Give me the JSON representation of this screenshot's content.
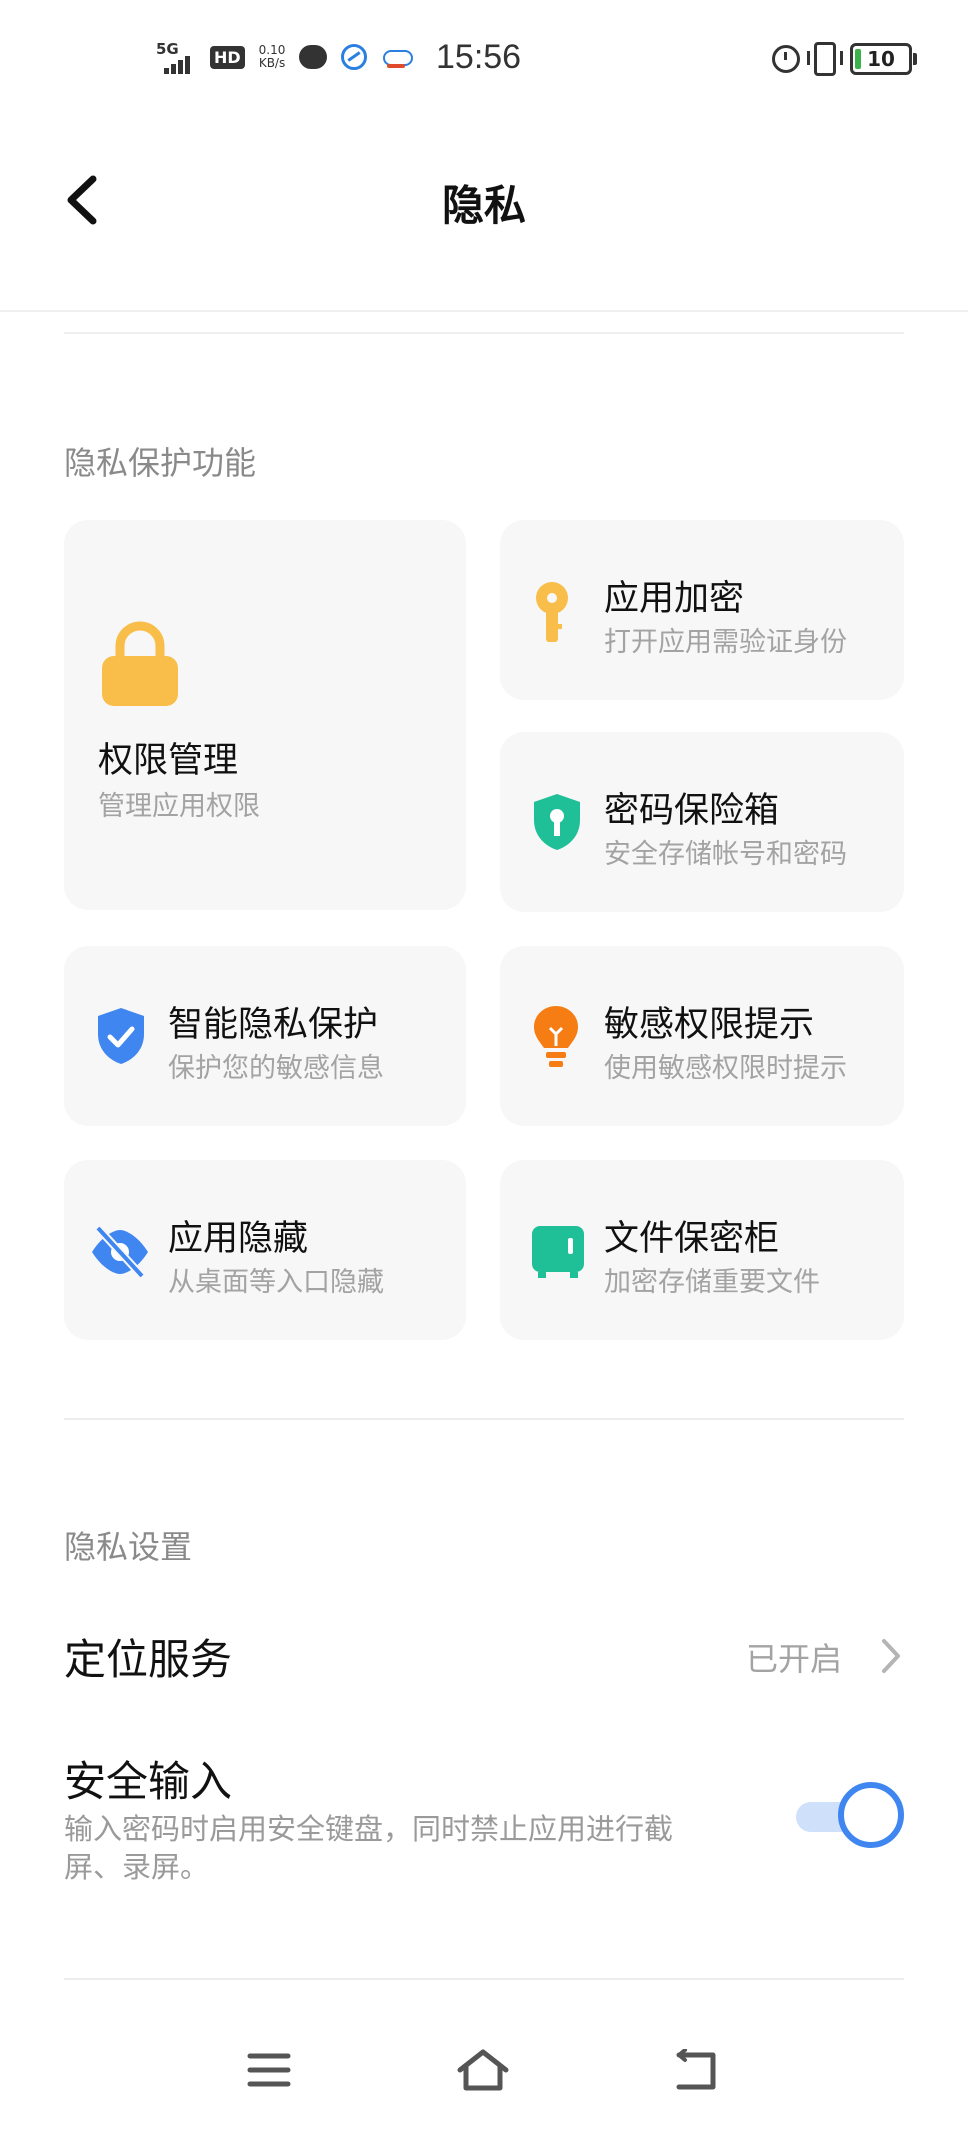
{
  "status_bar": {
    "network": "5G",
    "hd": "HD",
    "net_speed": "0.10",
    "net_unit": "KB/s",
    "time": "15:56",
    "battery": "10"
  },
  "header": {
    "title": "隐私"
  },
  "privacy_features": {
    "section_label": "隐私保护功能",
    "cards": [
      {
        "title": "权限管理",
        "subtitle": "管理应用权限",
        "icon": "lock-icon",
        "color": "#f9bd49"
      },
      {
        "title": "应用加密",
        "subtitle": "打开应用需验证身份",
        "icon": "key-icon",
        "color": "#f9bd49"
      },
      {
        "title": "密码保险箱",
        "subtitle": "安全存储帐号和密码",
        "icon": "shield-key-icon",
        "color": "#1fbf98"
      },
      {
        "title": "智能隐私保护",
        "subtitle": "保护您的敏感信息",
        "icon": "shield-check-icon",
        "color": "#3f86f0"
      },
      {
        "title": "敏感权限提示",
        "subtitle": "使用敏感权限时提示",
        "icon": "bulb-icon",
        "color": "#f57d14"
      },
      {
        "title": "应用隐藏",
        "subtitle": "从桌面等入口隐藏",
        "icon": "eye-off-icon",
        "color": "#3f86f0"
      },
      {
        "title": "文件保密柜",
        "subtitle": "加密存储重要文件",
        "icon": "safe-icon",
        "color": "#1fbf98"
      }
    ]
  },
  "privacy_settings": {
    "section_label": "隐私设置",
    "location": {
      "title": "定位服务",
      "value": "已开启"
    },
    "secure_input": {
      "title": "安全输入",
      "description": "输入密码时启用安全键盘，同时禁止应用进行截屏、录屏。",
      "enabled": true
    }
  },
  "colors": {
    "accent": "#3f86f0",
    "card_bg": "#f7f7f7"
  }
}
